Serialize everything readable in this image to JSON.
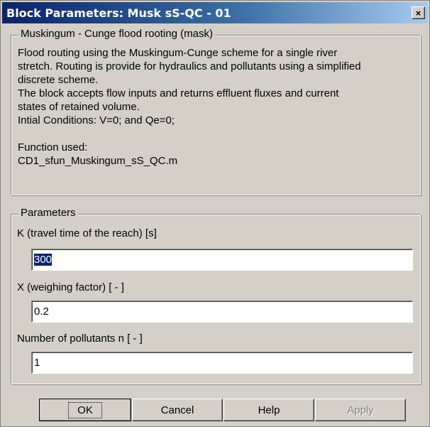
{
  "window": {
    "title": "Block Parameters: Musk sS-QC - 01",
    "close_glyph": "×"
  },
  "mask_group": {
    "legend": "Muskingum - Cunge flood rooting (mask)",
    "description_lines": [
      "Flood routing using the Muskingum-Cunge scheme for a single river",
      "stretch. Routing is provide for hydraulics and pollutants using a simplified",
      "discrete scheme.",
      "The block accepts flow inputs and returns effluent fluxes and current",
      "states of retained volume.",
      "Intial Conditions: V=0; and Qe=0;",
      "Function used:",
      "CD1_sfun_Muskingum_sS_QC.m"
    ]
  },
  "parameters_group": {
    "legend": "Parameters",
    "fields": [
      {
        "label": "K (travel time of the reach) [s]",
        "value": "300"
      },
      {
        "label": "X (weighing factor)  [ - ]",
        "value": "0.2"
      },
      {
        "label": "Number of pollutants n [ - ]",
        "value": "1"
      }
    ]
  },
  "buttons": {
    "ok": "OK",
    "cancel": "Cancel",
    "help": "Help",
    "apply": "Apply"
  },
  "colors": {
    "titlebar_start": "#0a246a",
    "titlebar_end": "#a6caf0",
    "dialog_face": "#d4d0c8",
    "selection": "#0a246a"
  }
}
